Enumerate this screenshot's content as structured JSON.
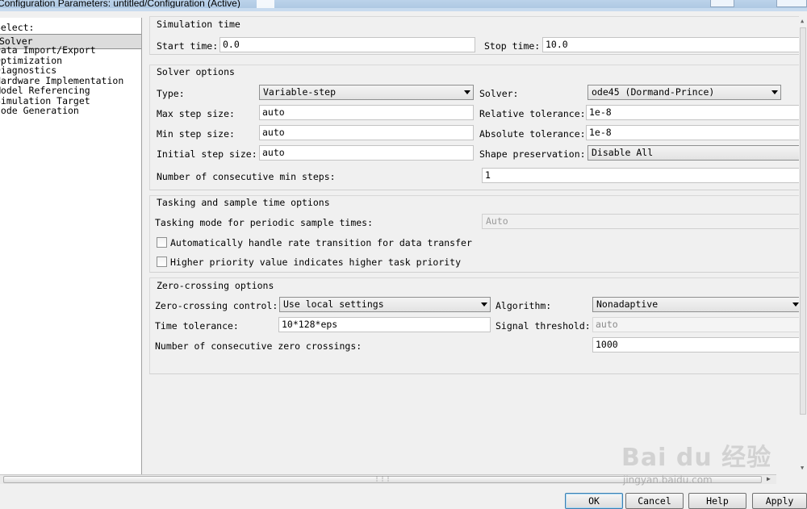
{
  "window": {
    "title": "Configuration Parameters: untitled/Configuration (Active)"
  },
  "tree": {
    "header": "Select:",
    "items": [
      "Solver",
      "Data Import/Export",
      "Optimization",
      "Diagnostics",
      "Hardware Implementation",
      "Model Referencing",
      "Simulation Target",
      "Code Generation"
    ]
  },
  "simulation_time": {
    "group_label": "Simulation time",
    "start_label": "Start time:",
    "start_value": "0.0",
    "stop_label": "Stop time:",
    "stop_value": "10.0"
  },
  "solver_options": {
    "group_label": "Solver options",
    "type_label": "Type:",
    "type_value": "Variable-step",
    "solver_label": "Solver:",
    "solver_value": "ode45 (Dormand-Prince)",
    "max_step_label": "Max step size:",
    "max_step_value": "auto",
    "rel_tol_label": "Relative tolerance:",
    "rel_tol_value": "1e-8",
    "min_step_label": "Min step size:",
    "min_step_value": "auto",
    "abs_tol_label": "Absolute tolerance:",
    "abs_tol_value": "1e-8",
    "init_step_label": "Initial step size:",
    "init_step_value": "auto",
    "shape_label": "Shape preservation:",
    "shape_value": "Disable All",
    "consec_min_label": "Number of consecutive min steps:",
    "consec_min_value": "1"
  },
  "tasking": {
    "group_label": "Tasking and sample time options",
    "mode_label": "Tasking mode for periodic sample times:",
    "mode_value": "Auto",
    "auto_rate_label": "Automatically handle rate transition for data transfer",
    "priority_label": "Higher priority value indicates higher task priority"
  },
  "zero_crossing": {
    "group_label": "Zero-crossing options",
    "control_label": "Zero-crossing control:",
    "control_value": "Use local settings",
    "algorithm_label": "Algorithm:",
    "algorithm_value": "Nonadaptive",
    "time_tol_label": "Time tolerance:",
    "time_tol_value": "10*128*eps",
    "signal_label": "Signal threshold:",
    "signal_value": "auto",
    "consec_zc_label": "Number of consecutive zero crossings:",
    "consec_zc_value": "1000"
  },
  "buttons": {
    "ok": "OK",
    "cancel": "Cancel",
    "help": "Help",
    "apply": "Apply"
  },
  "watermark": {
    "logo": "Bai du 经验",
    "url": "jingyan.baidu.com"
  }
}
